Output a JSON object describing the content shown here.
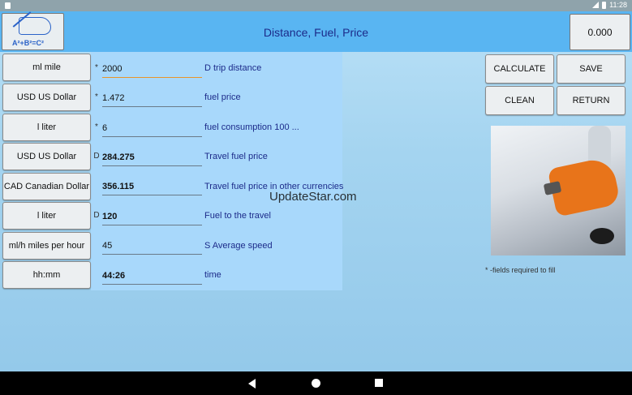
{
  "statusbar": {
    "time": "11:28"
  },
  "header": {
    "title": "Distance, Fuel, Price",
    "result": "0.000",
    "logo_formula": "A²+B²=C²"
  },
  "rows": [
    {
      "unit": "ml mile",
      "marker": "*",
      "value": "2000",
      "desc": "D trip distance",
      "bold": false
    },
    {
      "unit": "USD US Dollar",
      "marker": "*",
      "value": "1.472",
      "desc": "fuel price",
      "bold": false
    },
    {
      "unit": "l liter",
      "marker": "*",
      "value": "6",
      "desc": "fuel consumption 100 ...",
      "bold": false
    },
    {
      "unit": "USD US Dollar",
      "marker": "D",
      "value": "284.275",
      "desc": "Travel fuel price",
      "bold": true
    },
    {
      "unit": "CAD Canadian Dollar",
      "marker": "",
      "value": "356.115",
      "desc": "Travel fuel price in other currencies",
      "bold": true
    },
    {
      "unit": "l liter",
      "marker": "D",
      "value": "120",
      "desc": "Fuel  to the travel",
      "bold": true
    },
    {
      "unit": "ml/h miles per hour",
      "marker": "",
      "value": "45",
      "desc": "S Average speed",
      "bold": false
    },
    {
      "unit": "hh:mm",
      "marker": "",
      "value": "44:26",
      "desc": "time",
      "bold": true
    }
  ],
  "actions": {
    "calculate": "CALCULATE",
    "save": "SAVE",
    "clean": "CLEAN",
    "return": "RETURN"
  },
  "note": "* -fields required to fill",
  "watermark": "UpdateStar.com",
  "colors": {
    "header_bg": "#59b5f2",
    "form_bg": "#a8d8fb",
    "title_text": "#1c2b8a",
    "active_underline": "#e8942a"
  }
}
